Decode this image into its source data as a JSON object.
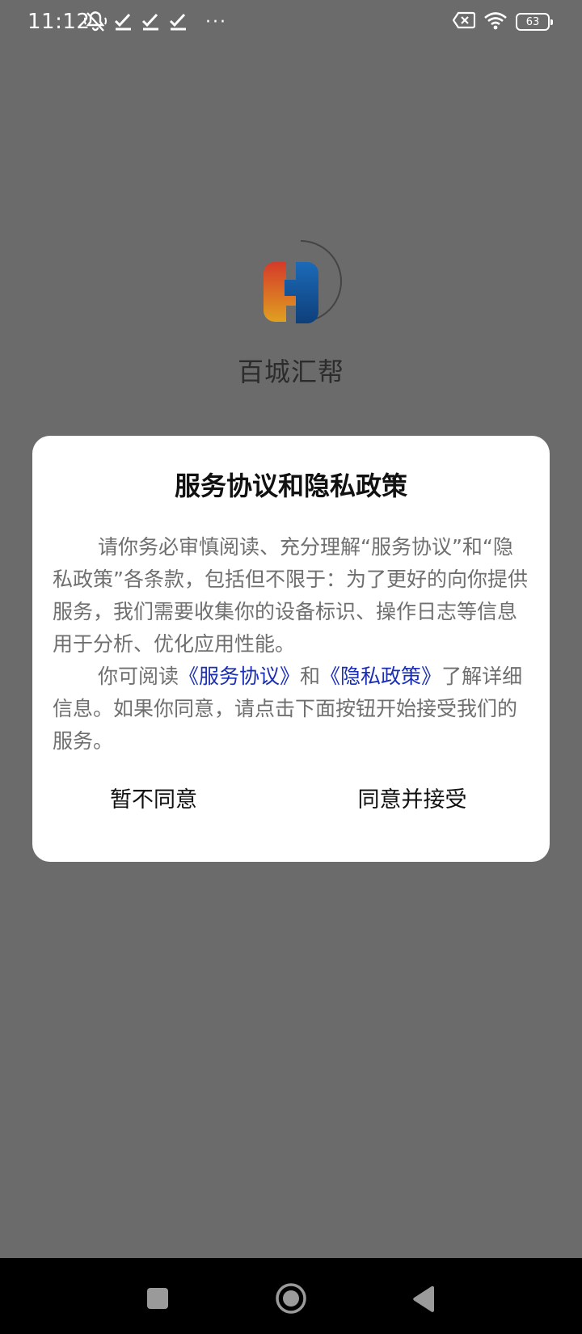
{
  "status_bar": {
    "time": "11:12",
    "battery_level": "63",
    "icons": [
      "mute-vibrate-icon",
      "check-icon",
      "check-icon",
      "check-icon",
      "more-dots-icon",
      "sim-error-icon",
      "wifi-icon",
      "battery-icon"
    ],
    "more_label": "···"
  },
  "app": {
    "name": "百城汇帮"
  },
  "dialog": {
    "title": "服务协议和隐私政策",
    "paragraph1": "请你务必审慎阅读、充分理解“服务协议”和“隐私政策”各条款，包括但不限于：为了更好的向你提供服务，我们需要收集你的设备标识、操作日志等信息用于分析、优化应用性能。",
    "paragraph2_prefix": "你可阅读",
    "service_agreement_link": "《服务协议》",
    "paragraph2_and": "和",
    "privacy_policy_link": "《隐私政策》",
    "paragraph2_suffix": "了解详细信息。如果你同意，请点击下面按钮开始接受我们的服务。",
    "decline_label": "暂不同意",
    "accept_label": "同意并接受"
  },
  "colors": {
    "overlay": "#6b6b6b",
    "dialog_bg": "#ffffff",
    "link": "#1a2fb4",
    "body_text": "#6f6f6f",
    "nav_bar": "#000000"
  }
}
